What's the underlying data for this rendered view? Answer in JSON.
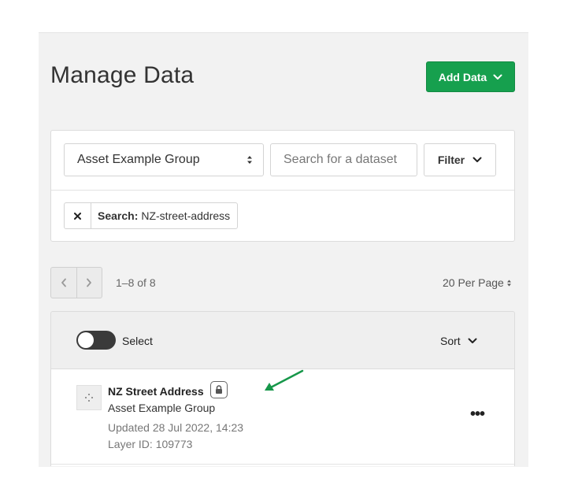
{
  "page": {
    "title": "Manage Data",
    "add_button_label": "Add Data"
  },
  "filters": {
    "group_select_value": "Asset Example Group",
    "search_placeholder": "Search for a dataset",
    "filter_label": "Filter",
    "active_chip_prefix": "Search:",
    "active_chip_value": "NZ-street-address"
  },
  "pagination": {
    "range_text": "1–8 of 8",
    "per_page_label": "20 Per Page"
  },
  "list_header": {
    "select_label": "Select",
    "sort_label": "Sort",
    "select_toggle_on": false
  },
  "datasets": [
    {
      "name": "NZ Street Address",
      "group": "Asset Example Group",
      "updated": "Updated 28 Jul 2022, 14:23",
      "layer_id": "Layer ID: 109773",
      "more_label": "•••"
    }
  ],
  "colors": {
    "primary_green": "#16a04e",
    "annotation_arrow": "#17974a"
  },
  "icons": {
    "add_chevron": "chevron-down-icon",
    "select_arrows": "sort-arrows-icon",
    "filter_chevron": "chevron-down-icon",
    "chip_remove": "close-icon",
    "pager_prev": "chevron-left-icon",
    "pager_next": "chevron-right-icon",
    "sort_chevron": "chevron-down-icon",
    "dataset_thumb": "point-layer-icon",
    "lock": "lock-icon",
    "annotation": "arrow-icon"
  }
}
